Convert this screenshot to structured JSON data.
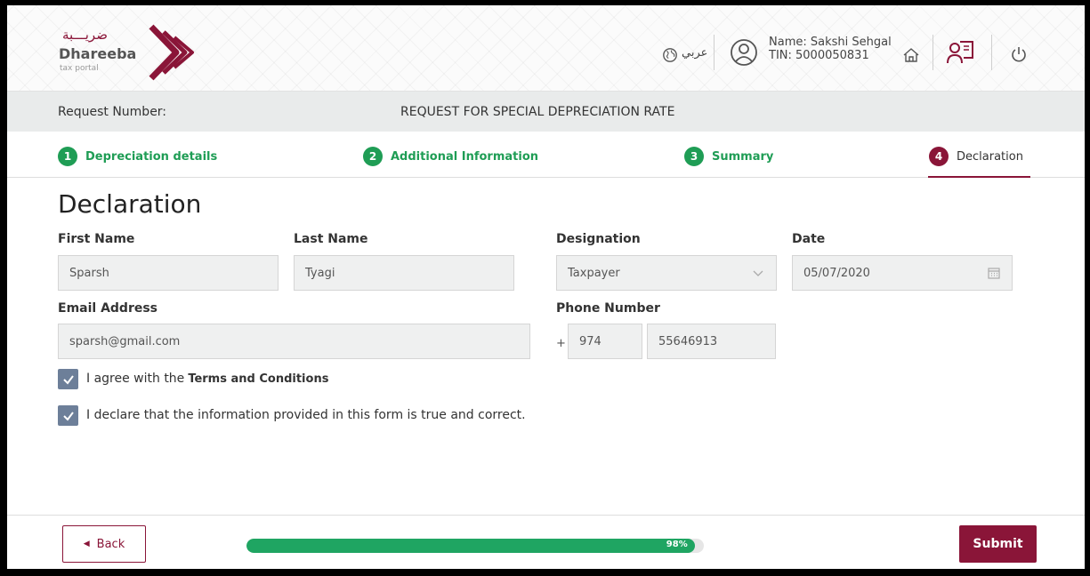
{
  "header": {
    "logo_arabic": "ضريـــبة",
    "logo_name": "Dhareeba",
    "logo_sub": "tax portal",
    "language_label": "عربي",
    "user_name": "Name: Sakshi Sehgal",
    "user_tin": "TIN: 5000050831",
    "icons": [
      "globe-icon",
      "user-icon",
      "home-icon",
      "book-icon",
      "power-icon"
    ]
  },
  "request": {
    "label": "Request Number:",
    "title": "REQUEST FOR SPECIAL DEPRECIATION RATE"
  },
  "steps": [
    {
      "num": "1",
      "label": "Depreciation details",
      "state": "done"
    },
    {
      "num": "2",
      "label": "Additional Information",
      "state": "done"
    },
    {
      "num": "3",
      "label": "Summary",
      "state": "done"
    },
    {
      "num": "4",
      "label": "Declaration",
      "state": "active"
    }
  ],
  "form": {
    "heading": "Declaration",
    "first_name": {
      "label": "First Name",
      "value": "Sparsh"
    },
    "last_name": {
      "label": "Last Name",
      "value": "Tyagi"
    },
    "designation": {
      "label": "Designation",
      "value": "Taxpayer"
    },
    "date": {
      "label": "Date",
      "value": "05/07/2020"
    },
    "email": {
      "label": "Email Address",
      "value": "sparsh@gmail.com"
    },
    "phone": {
      "label": "Phone Number",
      "plus": "+",
      "code": "974",
      "number": "55646913"
    },
    "agree_text": "I agree with the",
    "terms_link": "Terms and Conditions",
    "declare_text": "I declare that the information provided in this form is true and correct.",
    "agree_checked": true,
    "declare_checked": true
  },
  "footer": {
    "back_label": "Back",
    "progress_percent": 98,
    "progress_text": "98%",
    "submit_label": "Submit"
  },
  "colors": {
    "brand": "#8a1538",
    "success": "#1f9d55",
    "checkbox": "#6d7f99"
  }
}
